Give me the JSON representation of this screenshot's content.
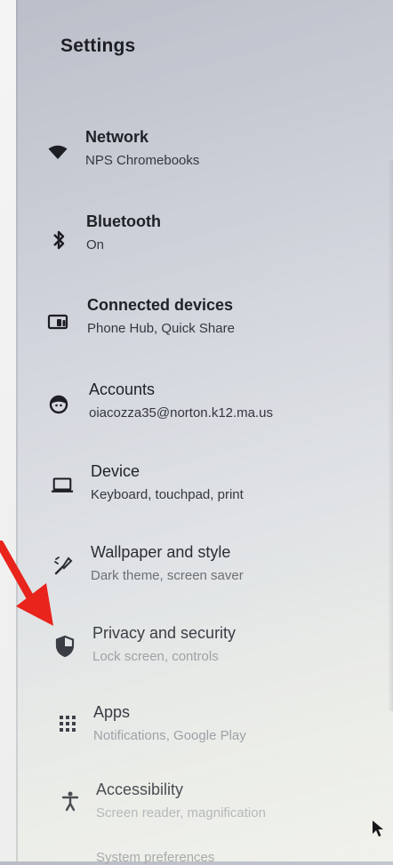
{
  "header": {
    "title": "Settings"
  },
  "items": [
    {
      "label": "Network",
      "sub": "NPS Chromebooks"
    },
    {
      "label": "Bluetooth",
      "sub": "On"
    },
    {
      "label": "Connected devices",
      "sub": "Phone Hub, Quick Share"
    },
    {
      "label": "Accounts",
      "sub": "oiacozza35@norton.k12.ma.us"
    },
    {
      "label": "Device",
      "sub": "Keyboard, touchpad, print"
    },
    {
      "label": "Wallpaper and style",
      "sub": "Dark theme, screen saver"
    },
    {
      "label": "Privacy and security",
      "sub": "Lock screen, controls"
    },
    {
      "label": "Apps",
      "sub": "Notifications, Google Play"
    },
    {
      "label": "Accessibility",
      "sub": "Screen reader, magnification"
    }
  ],
  "partial_item": {
    "label": "System preferences"
  },
  "colors": {
    "arrow": "#e8241c",
    "text": "#1e2126"
  }
}
